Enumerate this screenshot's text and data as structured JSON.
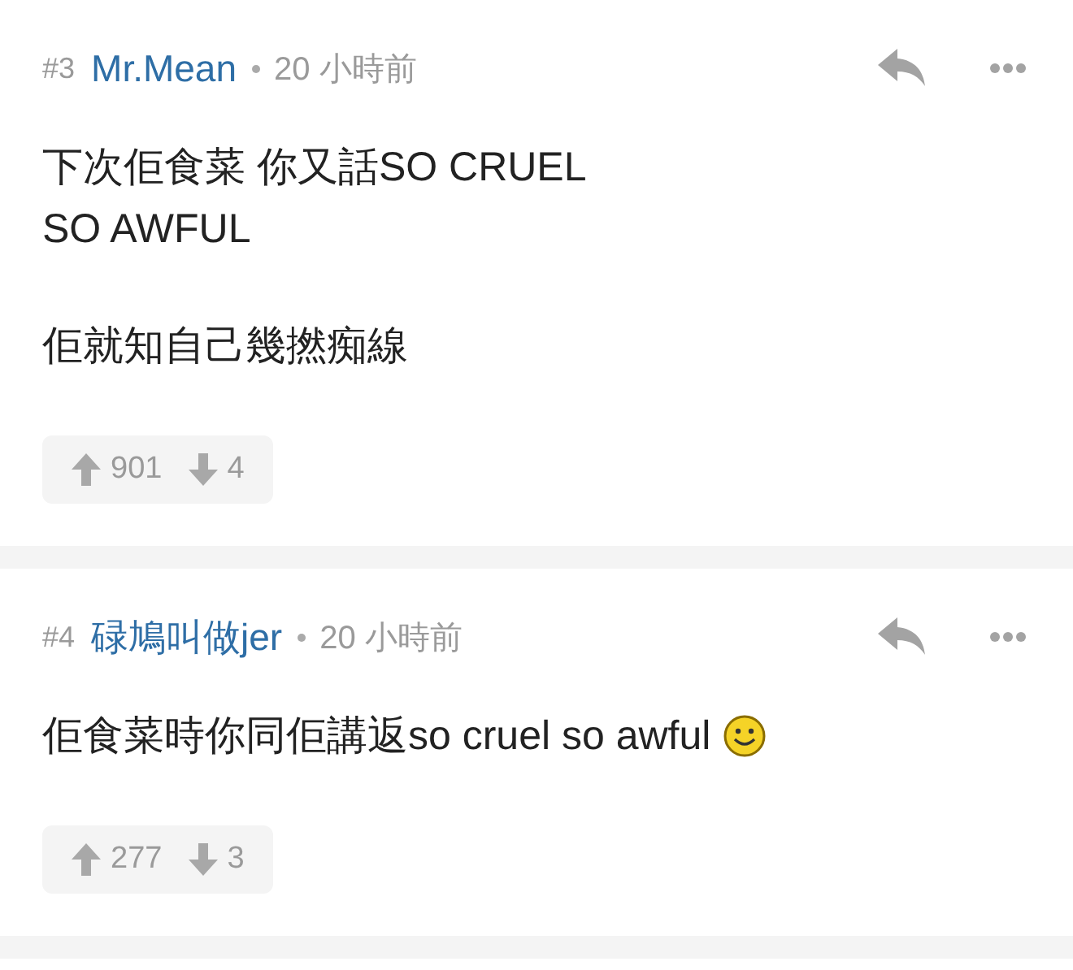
{
  "comments": [
    {
      "number": "#3",
      "author": "Mr.Mean",
      "time": "20 小時前",
      "paragraphs": [
        [
          "下次佢食菜 你又話SO CRUEL",
          "SO AWFUL"
        ],
        [
          "佢就知自己幾撚痴線"
        ]
      ],
      "ends_with_smiley": false,
      "upvotes": "901",
      "downvotes": "4"
    },
    {
      "number": "#4",
      "author": "碌鳩叫做jer",
      "time": "20 小時前",
      "paragraphs": [
        [
          "佢食菜時你同佢講返so cruel so awful"
        ]
      ],
      "ends_with_smiley": true,
      "upvotes": "277",
      "downvotes": "3"
    }
  ]
}
